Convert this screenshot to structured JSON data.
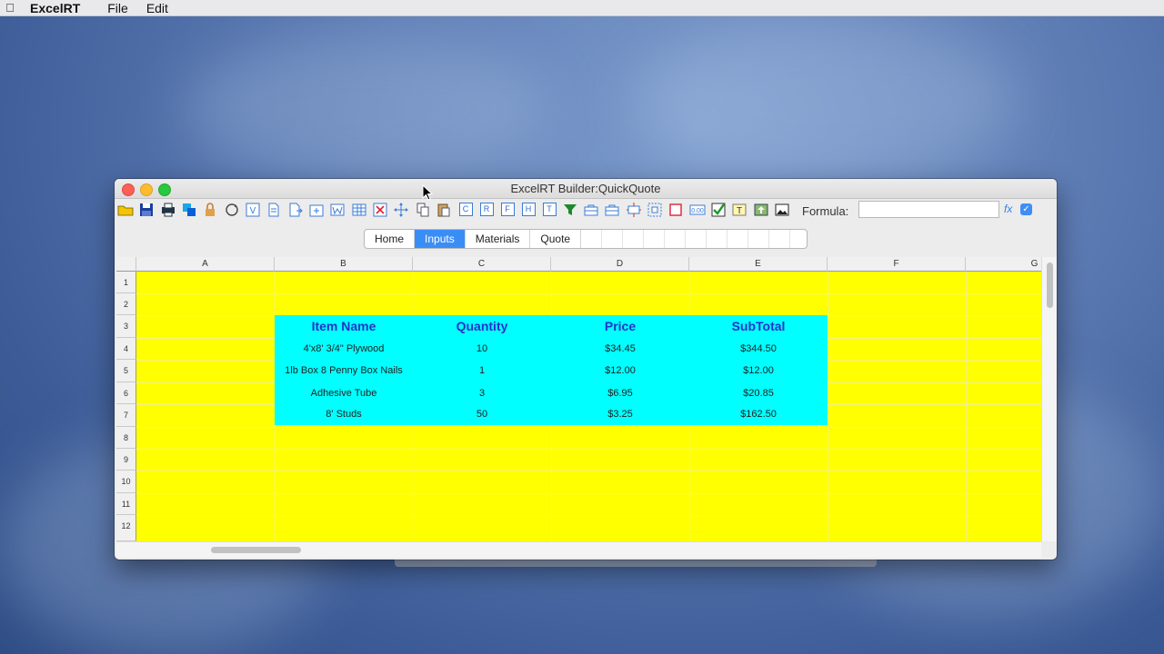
{
  "menubar": {
    "app": "ExcelRT",
    "items": [
      "File",
      "Edit"
    ]
  },
  "window": {
    "title": "ExcelRT Builder:QuickQuote"
  },
  "toolbar": {
    "formula_label": "Formula:",
    "formula_value": "",
    "fx_label": "fx",
    "icons": [
      "open-folder-icon",
      "save-icon",
      "print-icon",
      "copy-sheet-icon",
      "lock-icon",
      "refresh-icon",
      "v-icon",
      "document-icon",
      "insert-row-icon",
      "insert-column-icon",
      "w-icon",
      "grid-icon",
      "delete-icon",
      "move-icon",
      "copy-icon",
      "paste-icon",
      "c-icon",
      "r-icon",
      "f-icon",
      "h-icon",
      "t-icon",
      "filter-icon",
      "toolbox-icon",
      "toolbox2-icon",
      "expand-icon",
      "select-icon",
      "border-icon",
      "number-format-icon",
      "checkbox-icon",
      "textbox-icon",
      "image-up-icon",
      "picture-icon"
    ]
  },
  "tabs": [
    {
      "label": "Home",
      "active": false
    },
    {
      "label": "Inputs",
      "active": true
    },
    {
      "label": "Materials",
      "active": false
    },
    {
      "label": "Quote",
      "active": false
    }
  ],
  "columns": [
    "A",
    "B",
    "C",
    "D",
    "E",
    "F",
    "G"
  ],
  "rows": [
    "1",
    "2",
    "3",
    "4",
    "5",
    "6",
    "7",
    "8",
    "9",
    "10",
    "11",
    "12"
  ],
  "table": {
    "headers": [
      "Item Name",
      "Quantity",
      "Price",
      "SubTotal"
    ],
    "rows": [
      [
        "4'x8' 3/4\" Plywood",
        "10",
        "$34.45",
        "$344.50"
      ],
      [
        "1lb Box 8 Penny Box Nails",
        "1",
        "$12.00",
        "$12.00"
      ],
      [
        "Adhesive Tube",
        "3",
        "$6.95",
        "$20.85"
      ],
      [
        "8' Studs",
        "50",
        "$3.25",
        "$162.50"
      ]
    ]
  },
  "colors": {
    "sheet_bg": "#ffff00",
    "table_bg": "#00ffff",
    "header_text": "#2433c9",
    "accent": "#3b8df6"
  }
}
